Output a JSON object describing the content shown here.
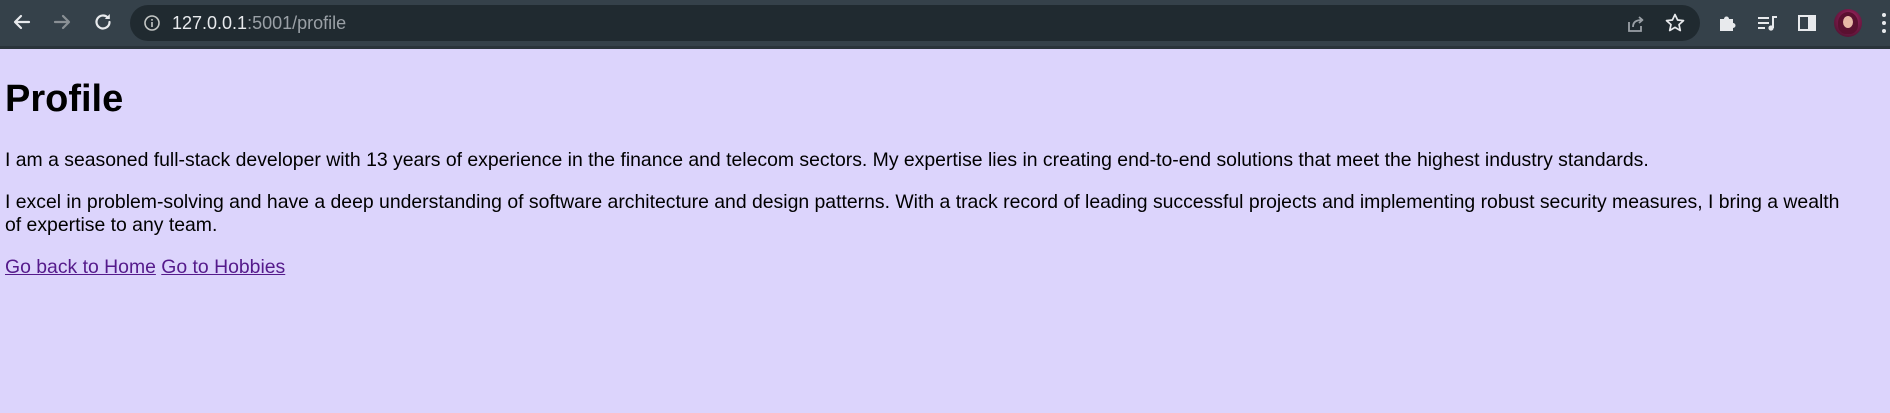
{
  "browser": {
    "url_host": "127.0.0.1",
    "url_rest": ":5001/profile",
    "icons": {
      "back": "arrow-left-icon",
      "forward": "arrow-right-icon",
      "reload": "reload-icon",
      "site_info": "info-icon",
      "share": "share-icon",
      "bookmark": "star-icon",
      "extensions": "puzzle-icon",
      "media": "media-playlist-icon",
      "side_panel": "side-panel-icon",
      "profile": "avatar",
      "menu": "kebab-menu-icon"
    },
    "colors": {
      "toolbar": "#35414a",
      "omnibox": "#202a30",
      "page_background": "#dcd4fc",
      "link": "#551a8b"
    }
  },
  "page": {
    "heading": "Profile",
    "paragraph1": "I am a seasoned full-stack developer with 13 years of experience in the finance and telecom sectors. My expertise lies in creating end-to-end solutions that meet the highest industry standards.",
    "paragraph2_line1": "I excel in problem-solving and have a deep understanding of software architecture and design patterns. With a track record of leading successful projects and implementing robust security measures, I bring a wealth",
    "paragraph2_line2": "of expertise to any team.",
    "links": {
      "home": "Go back to Home",
      "hobbies": "Go to Hobbies"
    }
  }
}
